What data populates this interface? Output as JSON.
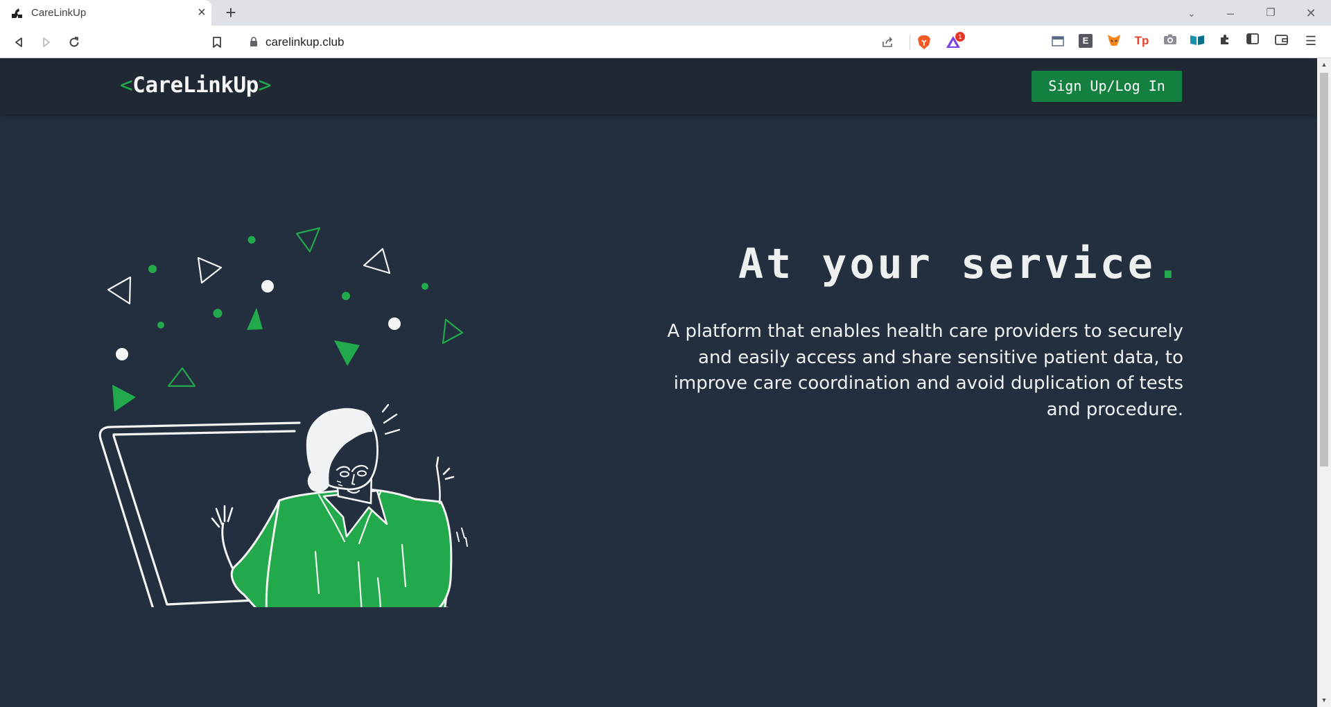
{
  "browser": {
    "tab_title": "CareLinkUp",
    "url": "carelinkup.club",
    "rewards_badge": "1"
  },
  "site": {
    "logo_open": "<",
    "logo_text": "CareLinkUp",
    "logo_close": ">",
    "auth_button": "Sign Up/Log In"
  },
  "hero": {
    "title": "At your service",
    "title_dot": ".",
    "description": "A platform that enables health care providers to securely and easily access and share sensitive patient data, to improve care coordination and avoid duplication of tests and procedure."
  },
  "colors": {
    "page_bg": "#232f3e",
    "header_bg": "#1f2833",
    "accent_green": "#22a94b",
    "button_green": "#148040",
    "text_light": "#eef0f0"
  }
}
